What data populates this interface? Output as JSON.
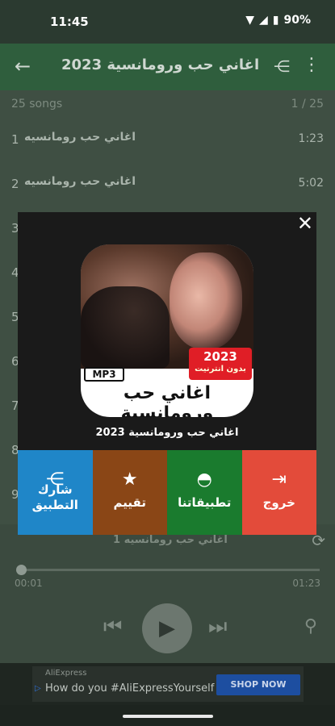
{
  "status": {
    "time": "11:45",
    "battery": "90%"
  },
  "appbar": {
    "title": "اغاني حب ورومانسية 2023",
    "back_icon": "arrow-back-icon",
    "share_icon": "share-icon",
    "more_icon": "more-vert-icon"
  },
  "list": {
    "count": "25 songs",
    "page": "1 / 25",
    "rows": [
      {
        "num": "1",
        "name": "اغاني  حب  رومانسيه",
        "dur": "1:23"
      },
      {
        "num": "2",
        "name": "اغاني  حب  رومانسيه",
        "dur": "5:02"
      },
      {
        "num": "3",
        "name": "",
        "dur": ""
      },
      {
        "num": "4",
        "name": "",
        "dur": ""
      },
      {
        "num": "5",
        "name": "",
        "dur": ""
      },
      {
        "num": "6",
        "name": "",
        "dur": ""
      },
      {
        "num": "7",
        "name": "",
        "dur": ""
      },
      {
        "num": "8",
        "name": "",
        "dur": ""
      },
      {
        "num": "9",
        "name": "",
        "dur": ""
      }
    ]
  },
  "player": {
    "now_title": "اغاني  حب  رومانسيه  1",
    "current_time": "00:01",
    "total_time": "01:23",
    "progress": 0.01
  },
  "dialog": {
    "badge_year": "2023",
    "badge_sub": "بدون انترنيت",
    "mp3": "MP3",
    "cover_title": "اغاني حب ورومانسية",
    "app_title": "اغاني حب ورومانسية 2023",
    "actions": {
      "share": "شارك\nالتطبيق",
      "rate": "تقييم",
      "apps": "تطبيقاتنا",
      "exit": "خروج"
    },
    "colors": {
      "share": "#1f86c8",
      "rate": "#8a4616",
      "apps": "#1a7b2e",
      "exit": "#e34b3a"
    }
  },
  "ad": {
    "brand": "AliExpress",
    "text": "How do you #AliExpressYourself",
    "button": "SHOP NOW"
  }
}
